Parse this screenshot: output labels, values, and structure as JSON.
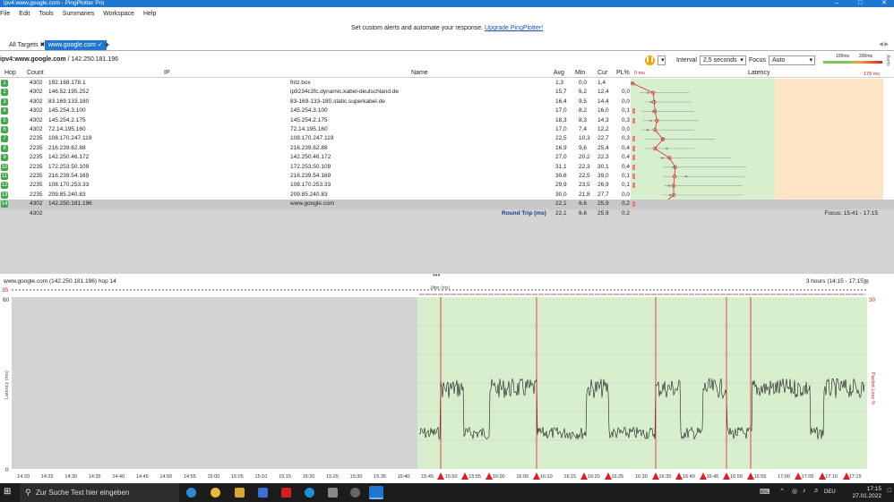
{
  "window": {
    "title": "ipv4:www.google.com - PingPlotter Pro"
  },
  "menu": [
    "File",
    "Edit",
    "Tools",
    "Summaries",
    "Workspace",
    "Help"
  ],
  "promo": {
    "text": "Set custom alerts and automate your response.",
    "link": "Upgrade PingPlotter!"
  },
  "tabs": {
    "all_targets": "All Targets",
    "active": "www.google.com",
    "add": "+"
  },
  "breadcrumb": {
    "target": "ipv4:www.google.com",
    "sep": " / ",
    "ip": "142.250.181.196"
  },
  "toolbar": {
    "interval_label": "Interval",
    "interval_value": "2,5 seconds",
    "focus_label": "Focus",
    "focus_value": "Auto",
    "legend_100": "100ms",
    "legend_200": "200ms"
  },
  "columns": {
    "hop": "Hop",
    "count": "Count",
    "ip": "IP",
    "name": "Name",
    "avg": "Avg",
    "min": "Min",
    "cur": "Cur",
    "pl": "PL%",
    "graph_zero": "0 ms",
    "latency": "Latency",
    "graph_max": "176 ms"
  },
  "hops": [
    {
      "hop": "1",
      "count": "4302",
      "ip": "192.168.178.1",
      "name": "fritz.box",
      "avg": "1,3",
      "min": "0,0",
      "cur": "1,4",
      "pl": ""
    },
    {
      "hop": "2",
      "count": "4302",
      "ip": "146.52.195.252",
      "name": "ip9234c3fc.dynamic.kabel-deutschland.de",
      "avg": "15,7",
      "min": "6,2",
      "cur": "12,4",
      "pl": "0,0"
    },
    {
      "hop": "3",
      "count": "4302",
      "ip": "83.169.133.180",
      "name": "83-169-133-180.static.superkabel.de",
      "avg": "16,4",
      "min": "9,5",
      "cur": "14,4",
      "pl": "0,0"
    },
    {
      "hop": "4",
      "count": "4302",
      "ip": "145.254.3.100",
      "name": "145.254.3.100",
      "avg": "17,0",
      "min": "8,2",
      "cur": "16,0",
      "pl": "0,1"
    },
    {
      "hop": "5",
      "count": "4302",
      "ip": "145.254.2.175",
      "name": "145.254.2.175",
      "avg": "18,3",
      "min": "8,3",
      "cur": "14,3",
      "pl": "0,3"
    },
    {
      "hop": "6",
      "count": "4302",
      "ip": "72.14.195.160",
      "name": "72.14.195.160",
      "avg": "17,0",
      "min": "7,4",
      "cur": "12,2",
      "pl": "0,0"
    },
    {
      "hop": "7",
      "count": "2235",
      "ip": "108.170.247.119",
      "name": "108.170.247.119",
      "avg": "22,5",
      "min": "10,3",
      "cur": "22,7",
      "pl": "0,3"
    },
    {
      "hop": "8",
      "count": "2235",
      "ip": "216.239.62.88",
      "name": "216.239.62.88",
      "avg": "16,9",
      "min": "9,6",
      "cur": "25,4",
      "pl": "0,4"
    },
    {
      "hop": "9",
      "count": "2235",
      "ip": "142.250.46.172",
      "name": "142.250.46.172",
      "avg": "27,0",
      "min": "20,2",
      "cur": "22,3",
      "pl": "0,4"
    },
    {
      "hop": "10",
      "count": "2235",
      "ip": "172.253.50.109",
      "name": "172.253.50.109",
      "avg": "31,1",
      "min": "22,3",
      "cur": "30,1",
      "pl": "0,4"
    },
    {
      "hop": "11",
      "count": "2235",
      "ip": "216.239.54.169",
      "name": "216.239.54.169",
      "avg": "30,6",
      "min": "22,5",
      "cur": "39,0",
      "pl": "0,1"
    },
    {
      "hop": "12",
      "count": "2235",
      "ip": "108.170.253.33",
      "name": "108.170.253.33",
      "avg": "29,9",
      "min": "23,5",
      "cur": "26,9",
      "pl": "0,1"
    },
    {
      "hop": "13",
      "count": "2235",
      "ip": "209.85.240.83",
      "name": "209.85.240.83",
      "avg": "30,0",
      "min": "21,8",
      "cur": "27,7",
      "pl": "0,0"
    },
    {
      "hop": "14",
      "count": "4302",
      "ip": "142.250.181.196",
      "name": "www.google.com",
      "avg": "22,1",
      "min": "6,6",
      "cur": "25,9",
      "pl": "0,2"
    }
  ],
  "summary": {
    "count": "4302",
    "label": "Round Trip (ms)",
    "avg": "22,1",
    "min": "6,6",
    "cur": "25,9",
    "pl": "0,2",
    "focus": "Focus: 15:41 - 17:15"
  },
  "lower": {
    "title": "www.google.com (142.250.181.196) hop 14",
    "range": "3 hours (14:15 - 17:15)",
    "jitter": "Jitter (ms)",
    "top_left": "35",
    "y_top": "60",
    "y_bottom": "0",
    "y_label": "Latency (ms)",
    "right_top": "30",
    "right_label": "Packet Loss %"
  },
  "time_ticks": [
    "14:20",
    "14:25",
    "14:30",
    "14:35",
    "14:40",
    "14:45",
    "14:50",
    "14:55",
    "15:00",
    "15:05",
    "15:10",
    "15:15",
    "15:20",
    "15:25",
    "15:30",
    "15:35",
    "15:40",
    "15:45",
    "15:50",
    "15:55",
    "16:00",
    "16:05",
    "16:10",
    "16:15",
    "16:20",
    "16:25",
    "16:30",
    "16:35",
    "16:40",
    "16:45",
    "16:50",
    "16:55",
    "17:00",
    "17:05",
    "17:10",
    "17:15"
  ],
  "taskbar": {
    "search": "Zur Suche Text hier eingeben",
    "lang": "DEU",
    "time": "17:15",
    "date": "27.01.2022"
  },
  "colors": {
    "accent": "#1e78d2",
    "hop_green": "#41a848",
    "graph_green": "#d8efce",
    "graph_orange": "#fde4c6",
    "loss_red": "#e02020"
  }
}
